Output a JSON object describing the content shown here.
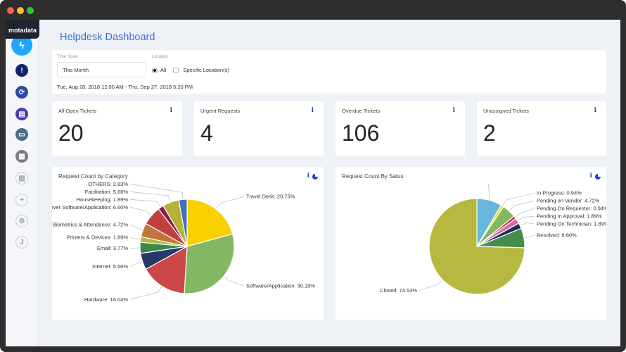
{
  "window": {
    "controls": {
      "close": "#ff5f57",
      "minimize": "#febc2e",
      "maximize": "#28c840"
    }
  },
  "logo": "motadata",
  "sidebar": {
    "items": [
      {
        "icon": "lightning-icon",
        "glyph": "ϟ",
        "color": "#1ea7fd",
        "active": true
      },
      {
        "icon": "alert-icon",
        "glyph": "!",
        "color": "#16216b"
      },
      {
        "icon": "refresh-icon",
        "glyph": "⟳",
        "color": "#2c4aa6"
      },
      {
        "icon": "book-icon",
        "glyph": "▤",
        "color": "#4b3bb0"
      },
      {
        "icon": "monitor-icon",
        "glyph": "▭",
        "color": "#4f6f86"
      },
      {
        "icon": "document-settings-icon",
        "glyph": "▦",
        "color": "#7b7b7b"
      },
      {
        "icon": "report-icon",
        "glyph": "▥",
        "outline": true
      },
      {
        "icon": "plus-icon",
        "glyph": "+",
        "outline": true
      },
      {
        "icon": "gear-icon",
        "glyph": "⚙",
        "outline": true
      },
      {
        "icon": "user-avatar",
        "glyph": "J",
        "outline": true
      }
    ]
  },
  "page_title": "Helpdesk Dashboard",
  "filters": {
    "time_scale_label": "Time Scale",
    "time_scale_value": "This Month",
    "location_label": "Location",
    "option_all": "All",
    "option_specific": "Specific Location(s)",
    "selected": "All",
    "date_range": "Tue, Aug 28, 2018 12:00 AM - Thu, Sep 27, 2018 5:20 PM"
  },
  "stats": [
    {
      "title": "All Open Tickets",
      "value": "20"
    },
    {
      "title": "Urgent Requests",
      "value": "4"
    },
    {
      "title": "Overdue Tickets",
      "value": "106"
    },
    {
      "title": "Unassigned Tickets",
      "value": "2"
    }
  ],
  "chart_data": [
    {
      "type": "pie",
      "title": "Request Count by Category",
      "unit": "%",
      "slices": [
        {
          "name": "Travel Desk",
          "value": 20.75,
          "color": "#f9d000"
        },
        {
          "name": "Software/Application",
          "value": 30.19,
          "color": "#84b761"
        },
        {
          "name": "Hardware",
          "value": 16.04,
          "color": "#cc4748"
        },
        {
          "name": "Internet",
          "value": 5.66,
          "color": "#27396b"
        },
        {
          "name": "Email",
          "value": 3.77,
          "color": "#3a8a4a"
        },
        {
          "name": "Printers & Devices",
          "value": 1.89,
          "color": "#b7b83f"
        },
        {
          "name": "Biometrics & Attendance",
          "value": 4.72,
          "color": "#c0773c"
        },
        {
          "name": "Server Software/Application",
          "value": 6.6,
          "color": "#c0403f"
        },
        {
          "name": "Housekeeping",
          "value": 1.89,
          "color": "#8b1a4a"
        },
        {
          "name": "Facilitation",
          "value": 5.66,
          "color": "#b5b335"
        },
        {
          "name": "OTHERS",
          "value": 2.83,
          "color": "#3f6fb5"
        }
      ]
    },
    {
      "type": "pie",
      "title": "Request Count By Satus",
      "unit": "%",
      "slices": [
        {
          "name": "",
          "value": 8.49,
          "color": "#67b7dc"
        },
        {
          "name": "In Progress",
          "value": 0.94,
          "color": "#fdd400"
        },
        {
          "name": "Pending on Vendor",
          "value": 4.72,
          "color": "#84b761"
        },
        {
          "name": "Pending On Requester",
          "value": 0.94,
          "color": "#cc2529"
        },
        {
          "name": "Pending In Approval",
          "value": 1.89,
          "color": "#d36ba6"
        },
        {
          "name": "Pending On Technician",
          "value": 1.89,
          "color": "#1c2b5a"
        },
        {
          "name": "Resolved",
          "value": 6.6,
          "color": "#448e4d"
        },
        {
          "name": "Closed",
          "value": 74.53,
          "color": "#b7b83f"
        }
      ]
    }
  ]
}
